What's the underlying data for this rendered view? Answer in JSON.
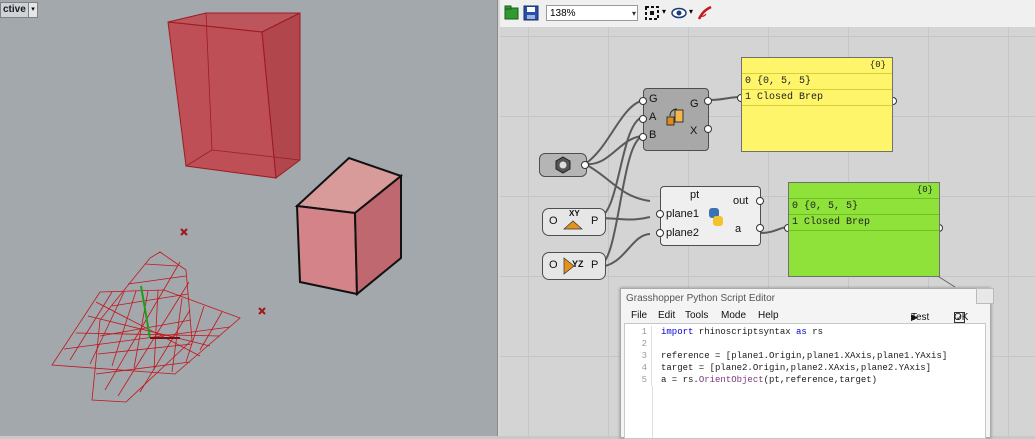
{
  "rhino": {
    "viewport_label": "ctive",
    "viewport_menu_glyph": "▾"
  },
  "grasshopper": {
    "toolbar": {
      "zoom_value": "138%",
      "zoom_arrow": "▾"
    },
    "orient_component": {
      "inputs": [
        "G",
        "A",
        "B"
      ],
      "outputs": [
        "G",
        "X"
      ]
    },
    "python_component": {
      "title_input": "pt",
      "inputs": [
        "plane1",
        "plane2"
      ],
      "outputs": [
        "out",
        "a"
      ]
    },
    "xy_plane": {
      "left": "O",
      "icon_text": "XY",
      "right": "P"
    },
    "yz_plane": {
      "left": "O",
      "icon_text": "YZ",
      "right": "P"
    },
    "panel_top": {
      "tag": "{0}",
      "rows": [
        "0 {0, 5, 5}",
        "1 Closed Brep"
      ]
    },
    "panel_bottom": {
      "tag": "{0}",
      "rows": [
        "0 {0, 5, 5}",
        "1 Closed Brep"
      ]
    },
    "colors": {
      "panel_yellow": "#fff56a",
      "panel_green": "#8fe23a",
      "component_grey": "#a8a8a8"
    }
  },
  "editor": {
    "title": "Grasshopper Python Script Editor",
    "menu": [
      "File",
      "Edit",
      "Tools",
      "Mode",
      "Help"
    ],
    "test_label": "Test",
    "ok_label": "OK",
    "line_numbers": [
      "1",
      "2",
      "3",
      "4",
      "5"
    ],
    "code": [
      "import rhinoscriptsyntax as rs",
      "",
      "reference = [plane1.Origin,plane1.XAxis,plane1.YAxis]",
      "target = [plane2.Origin,plane2.XAxis,plane2.YAxis]",
      "a = rs.OrientObject(pt,reference,target)"
    ]
  }
}
